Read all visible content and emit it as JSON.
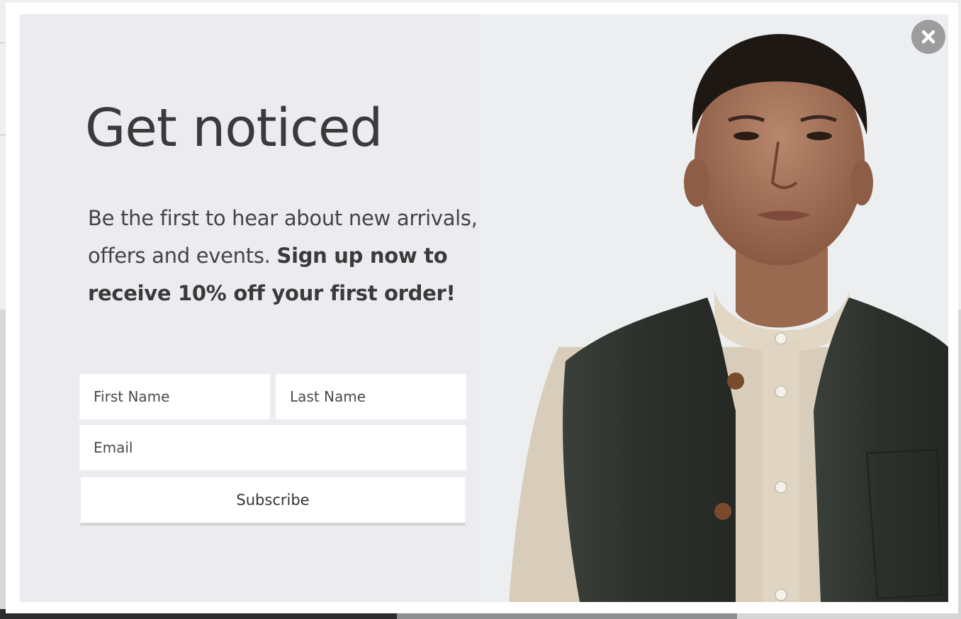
{
  "popup": {
    "title": "Get noticed",
    "intro_text": "Be the first to hear about new arrivals, offers and events.",
    "intro_bold": "Sign up now to receive 10% off your first order!",
    "first_name_placeholder": "First Name",
    "last_name_placeholder": "Last Name",
    "email_placeholder": "Email",
    "subscribe_label": "Subscribe",
    "close_icon": "close-icon",
    "image": "man-in-vest-photo"
  },
  "colors": {
    "panel_background": "#ebebf0",
    "title_text": "#3a3a3a",
    "close_button": "#9d9d9f",
    "vest": "#2f332e",
    "shirt": "#ddd2c0"
  }
}
